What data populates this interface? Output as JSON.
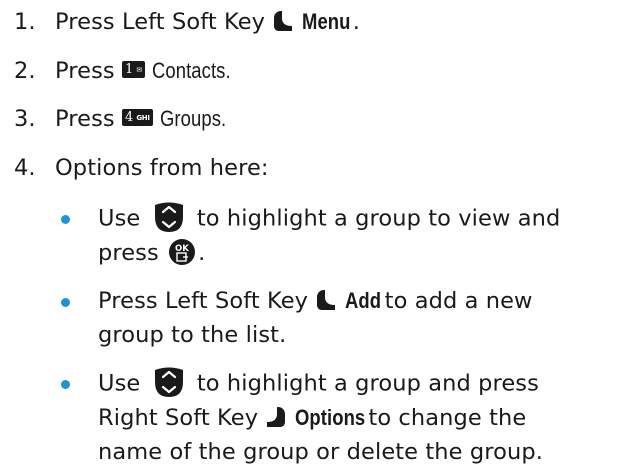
{
  "steps": [
    {
      "number": "1.",
      "text": "Press Left Soft Key",
      "bold_label": "Menu",
      "trailing": "."
    },
    {
      "number": "2.",
      "text": "Press",
      "key_digit": "1",
      "key_sub": "✉",
      "label": "Contacts."
    },
    {
      "number": "3.",
      "text": "Press",
      "key_digit": "4",
      "key_sub": "GHI",
      "label": "Groups."
    },
    {
      "number": "4.",
      "text": "Options from here:"
    }
  ],
  "options": [
    {
      "line1_a": "Use",
      "line1_b": "to highlight a group to view and",
      "line2_a": "press",
      "line2_b": "."
    },
    {
      "line1_a": "Press Left Soft Key",
      "bold_label": "Add",
      "line1_b": "to add a new",
      "line2": "group to the list."
    },
    {
      "line1_a": "Use",
      "line1_b": "to highlight a group and press",
      "line2_a": "Right Soft Key",
      "bold_label": "Options",
      "line2_b": "to change the",
      "line3": "name of the group or delete the group."
    }
  ],
  "icons": {
    "left_soft_key": "left-soft-key-icon",
    "right_soft_key": "right-soft-key-icon",
    "nav_key": "navigation-key-icon",
    "ok_key": "ok-key-icon"
  },
  "colors": {
    "text": "#1a1a1a",
    "bullet": "#1f93d6",
    "icon": "#1a1a1a"
  }
}
